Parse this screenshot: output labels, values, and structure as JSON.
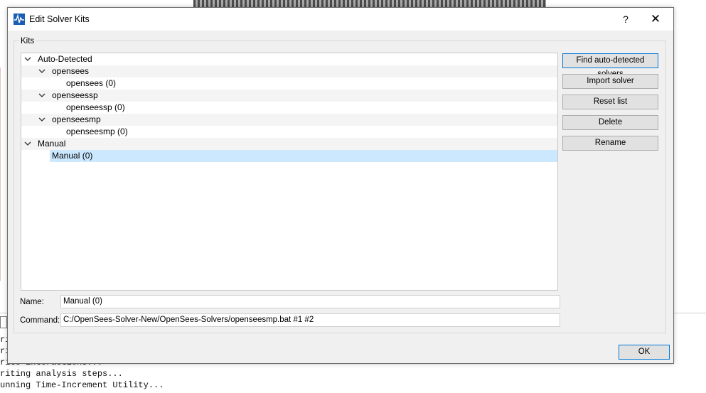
{
  "background": {
    "console_lines": [
      "riti",
      "riti",
      "rite interactions...",
      "riting analysis steps...",
      "unning Time-Increment Utility..."
    ]
  },
  "dialog": {
    "title": "Edit Solver Kits",
    "help_label": "?",
    "close_label": "✕",
    "group_label": "Kits",
    "tree": [
      {
        "label": "Auto-Detected",
        "level": 0,
        "expanded": true
      },
      {
        "label": "opensees",
        "level": 1,
        "expanded": true
      },
      {
        "label": "opensees (0)",
        "level": 2
      },
      {
        "label": "openseessp",
        "level": 1,
        "expanded": true
      },
      {
        "label": "openseessp (0)",
        "level": 2
      },
      {
        "label": "openseesmp",
        "level": 1,
        "expanded": true
      },
      {
        "label": "openseesmp (0)",
        "level": 2
      },
      {
        "label": "Manual",
        "level": 0,
        "expanded": true
      },
      {
        "label": "Manual (0)",
        "level": 1,
        "selected": true
      }
    ],
    "buttons": {
      "find": "Find auto-detected solvers",
      "import": "Import solver",
      "reset": "Reset list",
      "delete": "Delete",
      "rename": "Rename"
    },
    "name_label": "Name:",
    "name_value": "Manual (0)",
    "command_label": "Command:",
    "command_value": "C:/OpenSees-Solver-New/OpenSees-Solvers/openseesmp.bat #1 #2",
    "ok_label": "OK",
    "colors": {
      "selection": "#cce8ff",
      "focus_border": "#0078d7",
      "icon": "#1a5fb4"
    }
  }
}
